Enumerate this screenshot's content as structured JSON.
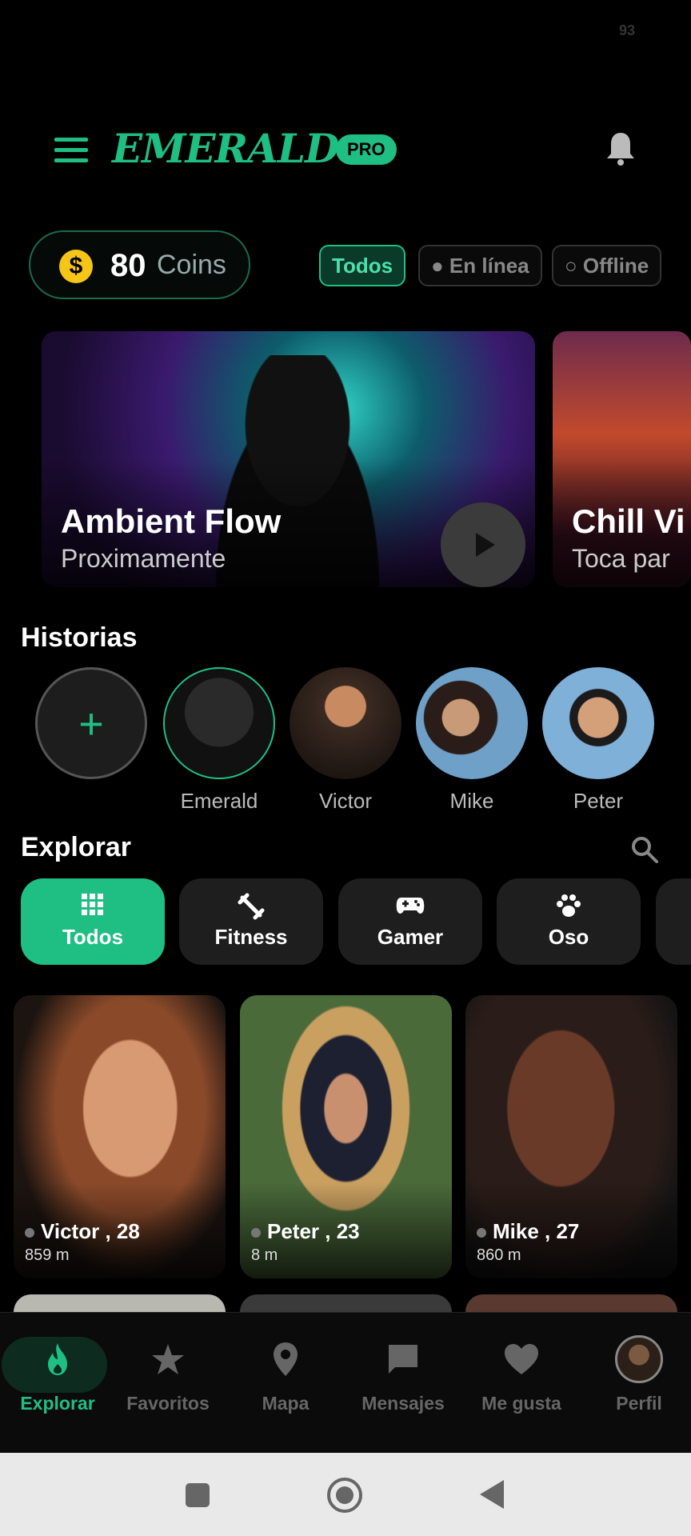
{
  "status": {
    "battery": "93"
  },
  "header": {
    "logo": "EMERALD",
    "badge": "PRO"
  },
  "coins": {
    "value": "80",
    "unit": "Coins",
    "icon": "$"
  },
  "status_filters": [
    {
      "label": "Todos"
    },
    {
      "label": "● En línea"
    },
    {
      "label": "○ Offline"
    }
  ],
  "featured": [
    {
      "title": "Ambient Flow",
      "subtitle": "Proximamente"
    },
    {
      "title": "Chill Vi",
      "subtitle": "Toca par"
    }
  ],
  "stories": {
    "title": "Historias",
    "add_icon": "+",
    "items": [
      {
        "name": "Emerald",
        "color": "#1a1a1a"
      },
      {
        "name": "Victor",
        "color": "#3a2a22"
      },
      {
        "name": "Mike",
        "color": "#3b6b8a"
      },
      {
        "name": "Peter",
        "color": "#5e86a8"
      }
    ]
  },
  "explore": {
    "title": "Explorar",
    "categories": [
      {
        "label": "Todos",
        "icon": "grid-icon"
      },
      {
        "label": "Fitness",
        "icon": "dumbbell-icon"
      },
      {
        "label": "Gamer",
        "icon": "gamepad-icon"
      },
      {
        "label": "Oso",
        "icon": "paw-icon"
      }
    ]
  },
  "profiles": [
    {
      "name": "Victor , 28",
      "distance": "859 m",
      "bg": "#5a3a2a"
    },
    {
      "name": "Peter , 23",
      "distance": "8 m",
      "bg": "#4a6a3a"
    },
    {
      "name": "Mike , 27",
      "distance": "860 m",
      "bg": "#2a1c18"
    }
  ],
  "nav": [
    {
      "label": "Explorar",
      "icon": "flame-icon"
    },
    {
      "label": "Favoritos",
      "icon": "star-icon"
    },
    {
      "label": "Mapa",
      "icon": "map-pin-icon"
    },
    {
      "label": "Mensajes",
      "icon": "chat-icon"
    },
    {
      "label": "Me gusta",
      "icon": "heart-icon"
    },
    {
      "label": "Perfil",
      "icon": "avatar"
    }
  ],
  "colors": {
    "accent": "#1fbf84",
    "background": "#000000"
  }
}
